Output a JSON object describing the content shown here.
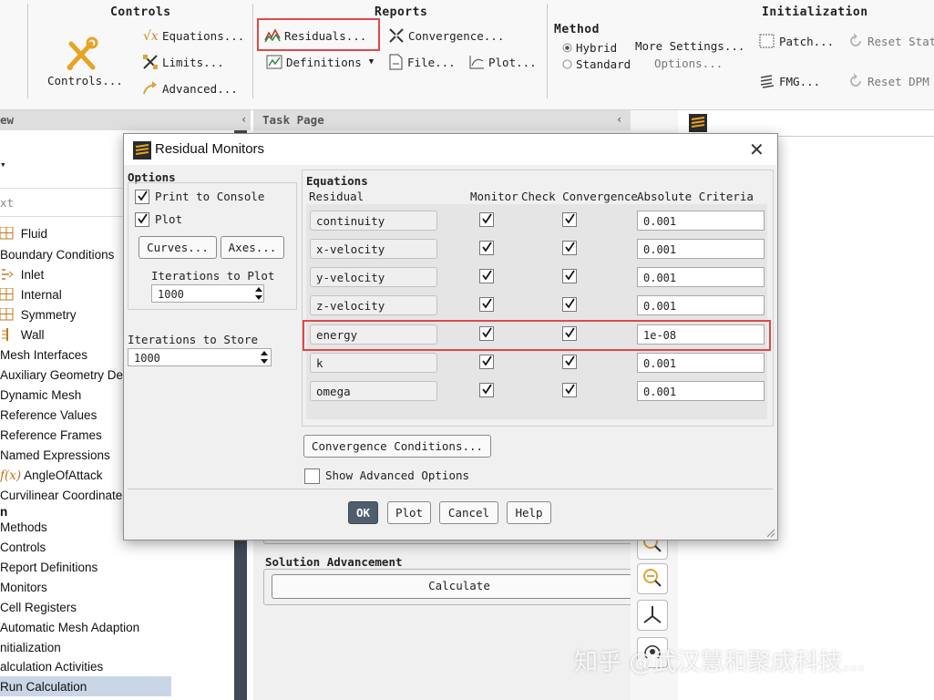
{
  "ribbon": {
    "controls": {
      "title": "Controls",
      "main_label": "Controls...",
      "equations": "Equations...",
      "limits": "Limits...",
      "advanced": "Advanced..."
    },
    "reports": {
      "title": "Reports",
      "residuals": "Residuals...",
      "convergence": "Convergence...",
      "definitions": "Definitions",
      "file": "File...",
      "plot": "Plot..."
    },
    "method": {
      "title": "Method",
      "hybrid": "Hybrid",
      "standard": "Standard",
      "more_settings": "More Settings...",
      "options": "Options...",
      "selected": "Hybrid"
    },
    "initialization": {
      "title": "Initialization",
      "patch": "Patch...",
      "reset_stat": "Reset Stat",
      "fmg": "FMG...",
      "reset_dpm": "Reset DPM"
    }
  },
  "tree": {
    "header_fragment": "ew",
    "filter_placeholder": "xt",
    "items": [
      "Fluid",
      "Boundary Conditions",
      "Inlet",
      "Internal",
      "Symmetry",
      "Wall",
      "Mesh Interfaces",
      "Auxiliary Geometry De",
      "Dynamic Mesh",
      "Reference Values",
      "Reference Frames",
      "Named Expressions",
      "AngleOfAttack",
      "Curvilinear Coordinate",
      "n",
      "Methods",
      "Controls",
      "Report Definitions",
      "Monitors",
      "Cell Registers",
      "Automatic Mesh Adaption",
      "nitialization",
      "alculation Activities",
      "Run Calculation"
    ],
    "selected": "Run Calculation"
  },
  "task_page": {
    "title": "Task Page",
    "solution_advancement": "Solution Advancement",
    "calculate": "Calculate"
  },
  "dialog": {
    "title": "Residual Monitors",
    "options": {
      "title": "Options",
      "print_to_console": "Print to Console",
      "plot": "Plot",
      "curves": "Curves...",
      "axes": "Axes...",
      "iterations_to_plot_label": "Iterations to Plot",
      "iterations_to_plot": "1000",
      "iterations_to_store_label": "Iterations to Store",
      "iterations_to_store": "1000"
    },
    "equations": {
      "title": "Equations",
      "headers": {
        "residual": "Residual",
        "monitor": "Monitor",
        "check_convergence": "Check Convergence",
        "absolute_criteria": "Absolute Criteria"
      },
      "rows": [
        {
          "name": "continuity",
          "criteria": "0.001"
        },
        {
          "name": "x-velocity",
          "criteria": "0.001"
        },
        {
          "name": "y-velocity",
          "criteria": "0.001"
        },
        {
          "name": "z-velocity",
          "criteria": "0.001"
        },
        {
          "name": "energy",
          "criteria": "1e-08"
        },
        {
          "name": "k",
          "criteria": "0.001"
        },
        {
          "name": "omega",
          "criteria": "0.001"
        }
      ]
    },
    "convergence_conditions": "Convergence Conditions...",
    "show_advanced": "Show Advanced Options",
    "buttons": {
      "ok": "OK",
      "plot": "Plot",
      "cancel": "Cancel",
      "help": "Help"
    }
  },
  "watermark": "知乎 @武汉慧和聚成科技...",
  "colors": {
    "highlight": "#e04848",
    "tree_selected": "#c9d6e6",
    "ok_button": "#4f5d6d"
  }
}
